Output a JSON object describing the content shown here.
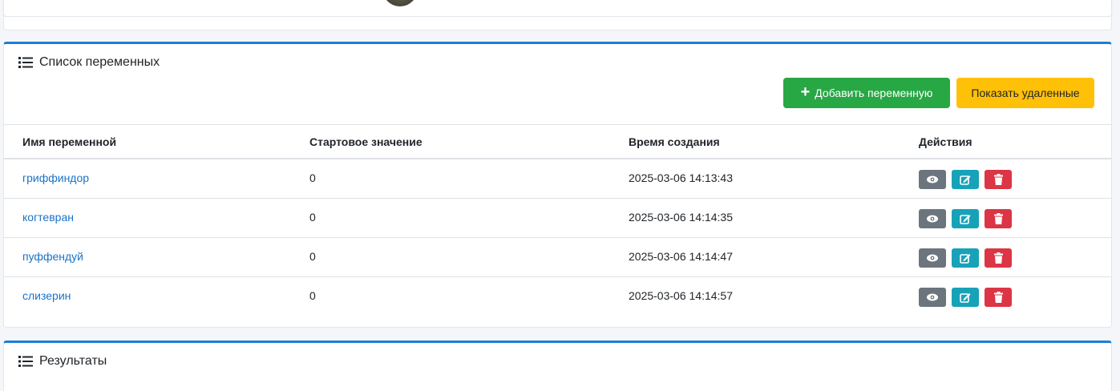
{
  "variables_card": {
    "title": "Список переменных",
    "add_button": "Добавить переменную",
    "show_deleted_button": "Показать удаленные",
    "columns": [
      "Имя переменной",
      "Стартовое значение",
      "Время создания",
      "Действия"
    ],
    "rows": [
      {
        "name": "гриффиндор",
        "start_value": "0",
        "created": "2025-03-06 14:13:43"
      },
      {
        "name": "когтевран",
        "start_value": "0",
        "created": "2025-03-06 14:14:35"
      },
      {
        "name": "пуффендуй",
        "start_value": "0",
        "created": "2025-03-06 14:14:47"
      },
      {
        "name": "слизерин",
        "start_value": "0",
        "created": "2025-03-06 14:14:57"
      }
    ]
  },
  "results_card": {
    "title": "Результаты"
  },
  "colors": {
    "accent": "#1c7ed6",
    "add": "#28a745",
    "show_deleted": "#ffc107",
    "view": "#6c757d",
    "edit": "#17a2b8",
    "delete": "#dc3545",
    "link": "#1a73c8"
  },
  "icons": {
    "title": "list-icon",
    "add": "plus-icon",
    "view": "eye-icon",
    "edit": "edit-icon",
    "delete": "trash-icon"
  }
}
